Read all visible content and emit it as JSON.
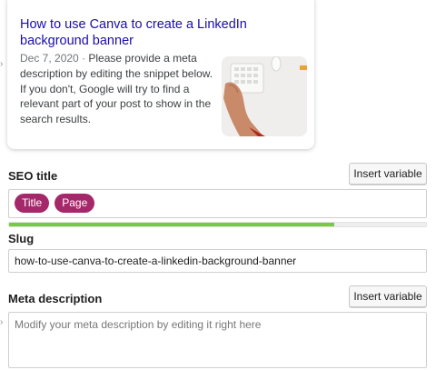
{
  "snippet": {
    "title": "How to use Canva to create a LinkedIn background banner",
    "date": "Dec 7, 2020",
    "separator": " · ",
    "description": "Please provide a meta description by editing the snippet below. If you don't, Google will try to find a relevant part of your post to show in the search results.",
    "thumbnail_icon": "keyboard-hand-photo"
  },
  "seo_title": {
    "label": "SEO title",
    "insert_button": "Insert variable",
    "variables": [
      "Title",
      "Page"
    ],
    "progress": 0.78,
    "progress_color": "#7ac943"
  },
  "slug": {
    "label": "Slug",
    "value": "how-to-use-canva-to-create-a-linkedin-background-banner"
  },
  "meta_description": {
    "label": "Meta description",
    "insert_button": "Insert variable",
    "placeholder": "Modify your meta description by editing it right here"
  },
  "colors": {
    "link": "#1a0dab",
    "variable_pill": "#a4286a"
  }
}
